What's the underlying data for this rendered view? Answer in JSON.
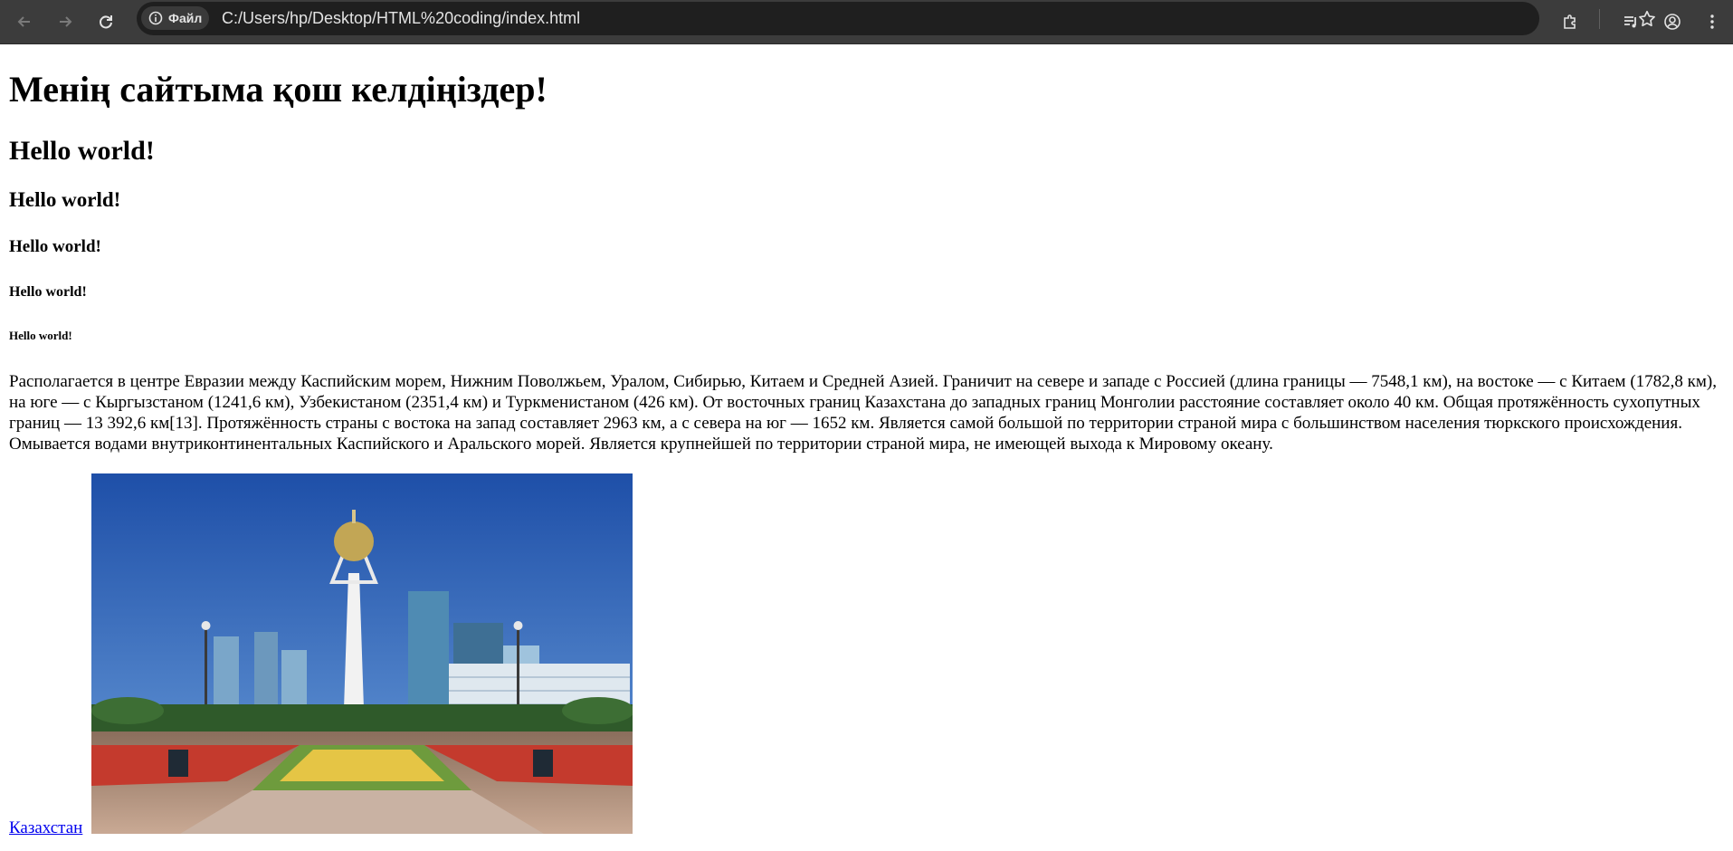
{
  "browser": {
    "site_chip_label": "Файл",
    "url": "C:/Users/hp/Desktop/HTML%20coding/index.html",
    "colors": {
      "toolbar": "#3c3c3c",
      "omnibox": "#1f1f1f",
      "text": "#e3e3e3"
    }
  },
  "page": {
    "h1": "Менің сайтыма қош келдіңіздер!",
    "h2": "Hello world!",
    "h3": "Hello world!",
    "h4": "Hello world!",
    "h5": "Hello world!",
    "h6": "Hello world!",
    "paragraph": "Располагается в центре Евразии между Каспийским морем, Нижним Поволжьем, Уралом, Сибирью, Китаем и Средней Азией. Граничит на севере и западе с Россией (длина границы — 7548,1 км), на востоке — с Китаем (1782,8 км), на юге — с Кыргызстаном (1241,6 км), Узбекистаном (2351,4 км) и Туркменистаном (426 км). От восточных границ Казахстана до западных границ Монголии расстояние составляет около 40 км. Общая протяжённость сухопутных границ — 13 392,6 км[13]. Протяжённость страны с востока на запад составляет 2963 км, а с севера на юг — 1652 км. Является самой большой по территории страной мира с большинством населения тюркского происхождения. Омывается водами внутриконтинентальных Каспийского и Аральского морей. Является крупнейшей по территории страной мира, не имеющей выхода к Мировому океану.",
    "link_text": "Казахстан",
    "link_color": "#0000ee"
  }
}
